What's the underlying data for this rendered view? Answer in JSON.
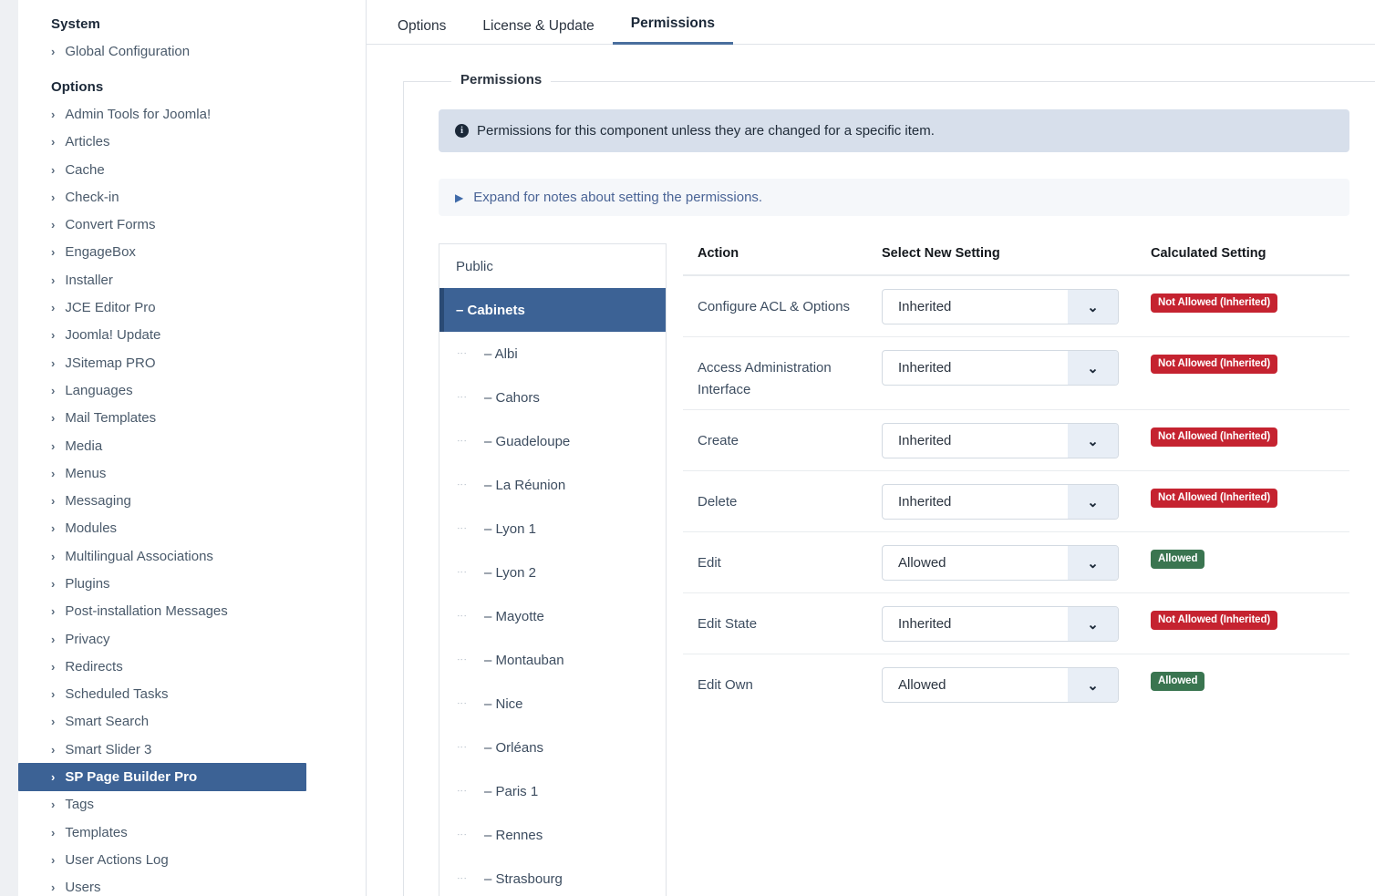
{
  "sidebar": {
    "groups": [
      {
        "heading": "System",
        "items": [
          {
            "label": "Global Configuration",
            "active": false
          }
        ]
      },
      {
        "heading": "Options",
        "items": [
          {
            "label": "Admin Tools for Joomla!",
            "active": false
          },
          {
            "label": "Articles",
            "active": false
          },
          {
            "label": "Cache",
            "active": false
          },
          {
            "label": "Check-in",
            "active": false
          },
          {
            "label": "Convert Forms",
            "active": false
          },
          {
            "label": "EngageBox",
            "active": false
          },
          {
            "label": "Installer",
            "active": false
          },
          {
            "label": "JCE Editor Pro",
            "active": false
          },
          {
            "label": "Joomla! Update",
            "active": false
          },
          {
            "label": "JSitemap PRO",
            "active": false
          },
          {
            "label": "Languages",
            "active": false
          },
          {
            "label": "Mail Templates",
            "active": false
          },
          {
            "label": "Media",
            "active": false
          },
          {
            "label": "Menus",
            "active": false
          },
          {
            "label": "Messaging",
            "active": false
          },
          {
            "label": "Modules",
            "active": false
          },
          {
            "label": "Multilingual Associations",
            "active": false
          },
          {
            "label": "Plugins",
            "active": false
          },
          {
            "label": "Post-installation Messages",
            "active": false
          },
          {
            "label": "Privacy",
            "active": false
          },
          {
            "label": "Redirects",
            "active": false
          },
          {
            "label": "Scheduled Tasks",
            "active": false
          },
          {
            "label": "Smart Search",
            "active": false
          },
          {
            "label": "Smart Slider 3",
            "active": false
          },
          {
            "label": "SP Page Builder Pro",
            "active": true
          },
          {
            "label": "Tags",
            "active": false
          },
          {
            "label": "Templates",
            "active": false
          },
          {
            "label": "User Actions Log",
            "active": false
          },
          {
            "label": "Users",
            "active": false
          }
        ]
      }
    ],
    "chevron_icon": "›"
  },
  "tabs": [
    {
      "label": "Options",
      "active": false
    },
    {
      "label": "License & Update",
      "active": false
    },
    {
      "label": "Permissions",
      "active": true
    }
  ],
  "fieldset": {
    "legend": "Permissions"
  },
  "alert": {
    "icon": "i",
    "text": "Permissions for this component unless they are changed for a specific item."
  },
  "notes": {
    "icon": "▶",
    "text": "Expand for notes about setting the permissions."
  },
  "group_list": [
    {
      "label": "Public",
      "child": false,
      "active": false
    },
    {
      "label": "– Cabinets",
      "child": false,
      "active": true
    },
    {
      "label": "– Albi",
      "child": true,
      "active": false
    },
    {
      "label": "– Cahors",
      "child": true,
      "active": false
    },
    {
      "label": "– Guadeloupe",
      "child": true,
      "active": false
    },
    {
      "label": "– La Réunion",
      "child": true,
      "active": false
    },
    {
      "label": "– Lyon 1",
      "child": true,
      "active": false
    },
    {
      "label": "– Lyon 2",
      "child": true,
      "active": false
    },
    {
      "label": "– Mayotte",
      "child": true,
      "active": false
    },
    {
      "label": "– Montauban",
      "child": true,
      "active": false
    },
    {
      "label": "– Nice",
      "child": true,
      "active": false
    },
    {
      "label": "– Orléans",
      "child": true,
      "active": false
    },
    {
      "label": "– Paris 1",
      "child": true,
      "active": false
    },
    {
      "label": "– Rennes",
      "child": true,
      "active": false
    },
    {
      "label": "– Strasbourg",
      "child": true,
      "active": false
    }
  ],
  "table": {
    "headers": [
      "Action",
      "Select New Setting",
      "Calculated Setting"
    ],
    "chevron_icon": "⌄",
    "rows": [
      {
        "action": "Configure ACL & Options",
        "setting": "Inherited",
        "calculated": "Not Allowed (Inherited)",
        "state": "red"
      },
      {
        "action": "Access Administration Interface",
        "setting": "Inherited",
        "calculated": "Not Allowed (Inherited)",
        "state": "red"
      },
      {
        "action": "Create",
        "setting": "Inherited",
        "calculated": "Not Allowed (Inherited)",
        "state": "red"
      },
      {
        "action": "Delete",
        "setting": "Inherited",
        "calculated": "Not Allowed (Inherited)",
        "state": "red"
      },
      {
        "action": "Edit",
        "setting": "Allowed",
        "calculated": "Allowed",
        "state": "green"
      },
      {
        "action": "Edit State",
        "setting": "Inherited",
        "calculated": "Not Allowed (Inherited)",
        "state": "red"
      },
      {
        "action": "Edit Own",
        "setting": "Allowed",
        "calculated": "Allowed",
        "state": "green"
      }
    ]
  },
  "colors": {
    "accent_blue": "#3c6295",
    "active_tab_underline": "#4a6f9e",
    "badge_red": "#c52330",
    "badge_green": "#3a7550",
    "alert_info_bg": "#d7dfeb"
  }
}
